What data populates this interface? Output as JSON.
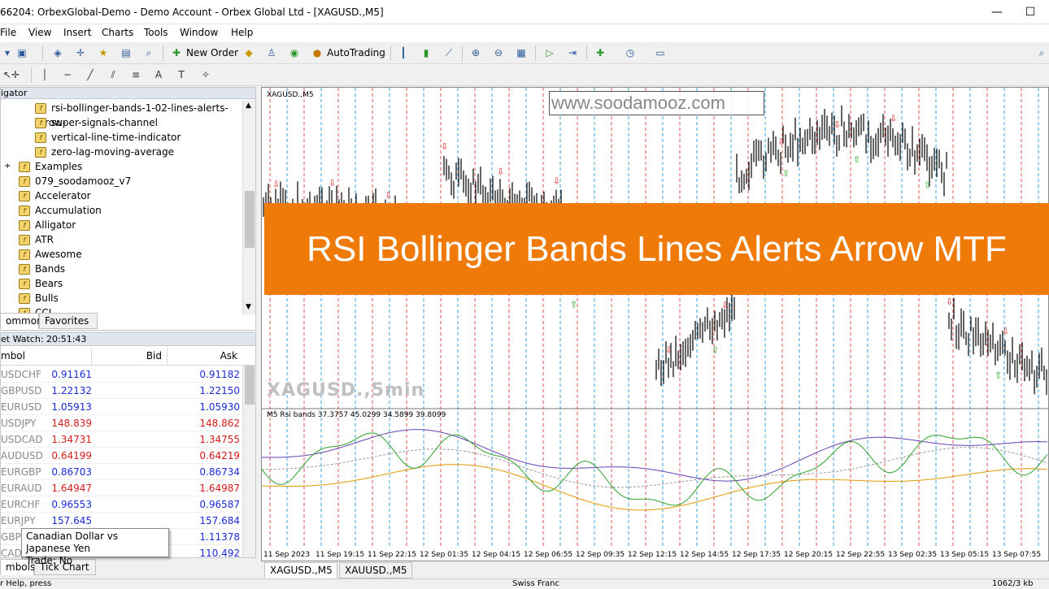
{
  "window": {
    "title": "66204: OrbexGlobal-Demo - Demo Account - Orbex Global Ltd - [XAGUSD.,M5]",
    "minimize": "—",
    "close": "☐"
  },
  "menu": [
    "File",
    "View",
    "Insert",
    "Charts",
    "Tools",
    "Window",
    "Help"
  ],
  "toolbar": {
    "new_order": "New Order",
    "autotrading": "AutoTrading"
  },
  "navigator": {
    "title": "igator",
    "items": [
      {
        "label": "rsi-bollinger-bands-1-02-lines-alerts-arrow-",
        "level": 2
      },
      {
        "label": "super-signals-channel",
        "level": 2
      },
      {
        "label": "vertical-line-time-indicator",
        "level": 2
      },
      {
        "label": "zero-lag-moving-average",
        "level": 2
      },
      {
        "label": "Examples",
        "level": 1,
        "expand": "+"
      },
      {
        "label": "079_soodamooz_v7",
        "level": 1
      },
      {
        "label": "Accelerator",
        "level": 1
      },
      {
        "label": "Accumulation",
        "level": 1
      },
      {
        "label": "Alligator",
        "level": 1
      },
      {
        "label": "ATR",
        "level": 1
      },
      {
        "label": "Awesome",
        "level": 1
      },
      {
        "label": "Bands",
        "level": 1
      },
      {
        "label": "Bears",
        "level": 1
      },
      {
        "label": "Bulls",
        "level": 1
      },
      {
        "label": "CCI",
        "level": 1
      }
    ],
    "tabs": [
      "ommon",
      "Favorites"
    ]
  },
  "market_watch": {
    "title": "et Watch: 20:51:43",
    "columns": [
      "mbol",
      "Bid",
      "Ask"
    ],
    "rows": [
      {
        "symbol": "USDCHF",
        "bid": "0.91161",
        "ask": "0.91182",
        "dir": "up"
      },
      {
        "symbol": "GBPUSD",
        "bid": "1.22132",
        "ask": "1.22150",
        "dir": "up"
      },
      {
        "symbol": "EURUSD",
        "bid": "1.05913",
        "ask": "1.05930",
        "dir": "up"
      },
      {
        "symbol": "USDJPY",
        "bid": "148.839",
        "ask": "148.862",
        "dir": "dn"
      },
      {
        "symbol": "USDCAD",
        "bid": "1.34731",
        "ask": "1.34755",
        "dir": "dn"
      },
      {
        "symbol": "AUDUSD",
        "bid": "0.64199",
        "ask": "0.64219",
        "dir": "dn"
      },
      {
        "symbol": "EURGBP",
        "bid": "0.86703",
        "ask": "0.86734",
        "dir": "up"
      },
      {
        "symbol": "EURAUD",
        "bid": "1.64947",
        "ask": "1.64987",
        "dir": "dn"
      },
      {
        "symbol": "EURCHF",
        "bid": "0.96553",
        "ask": "0.96587",
        "dir": "up"
      },
      {
        "symbol": "EURJPY",
        "bid": "157.645",
        "ask": "157.684",
        "dir": "up"
      },
      {
        "symbol": "GBPC",
        "bid": "",
        "ask": "1.11378",
        "dir": "up"
      },
      {
        "symbol": "CADJ",
        "bid": "",
        "ask": "110.492",
        "dir": "up"
      }
    ],
    "tabs": [
      "mbols",
      "Tick Chart"
    ],
    "tooltip_line1": "Canadian Dollar vs Japanese Yen",
    "tooltip_line2": "Trade: No"
  },
  "chart": {
    "symbol_label": "XAGUSD.,M5",
    "watermark_url": "www.soodamooz.com",
    "big_label": "XAGUSD.,5min",
    "indicator_label": "M5 Rsi bands 37.3757 45.0299 34.5899 39.8099",
    "banner": "RSI Bollinger Bands Lines Alerts Arrow MTF",
    "time_labels": [
      "11 Sep 2023",
      "11 Sep 19:15",
      "11 Sep 22:15",
      "12 Sep 01:35",
      "12 Sep 04:15",
      "12 Sep 06:55",
      "12 Sep 09:35",
      "12 Sep 12:15",
      "12 Sep 14:55",
      "12 Sep 17:35",
      "12 Sep 20:15",
      "12 Sep 22:55",
      "13 Sep 02:35",
      "13 Sep 05:15",
      "13 Sep 07:55"
    ],
    "tabs": [
      "XAGUSD.,M5",
      "XAUUSD.,M5"
    ],
    "colors": {
      "banner": "#f07a08",
      "rsi": "#2ca02c",
      "upper": "#6a3fb5",
      "lower": "#e09a00",
      "mid": "#999999",
      "buy_arrow": "#22aa22",
      "sell_arrow": "#dd2222",
      "vline_red": "#e05050",
      "vline_blue": "#3aa0d8"
    }
  },
  "status": {
    "left": "r Help, press",
    "mid": "Swiss Franc",
    "right": "1062/3 kb"
  }
}
